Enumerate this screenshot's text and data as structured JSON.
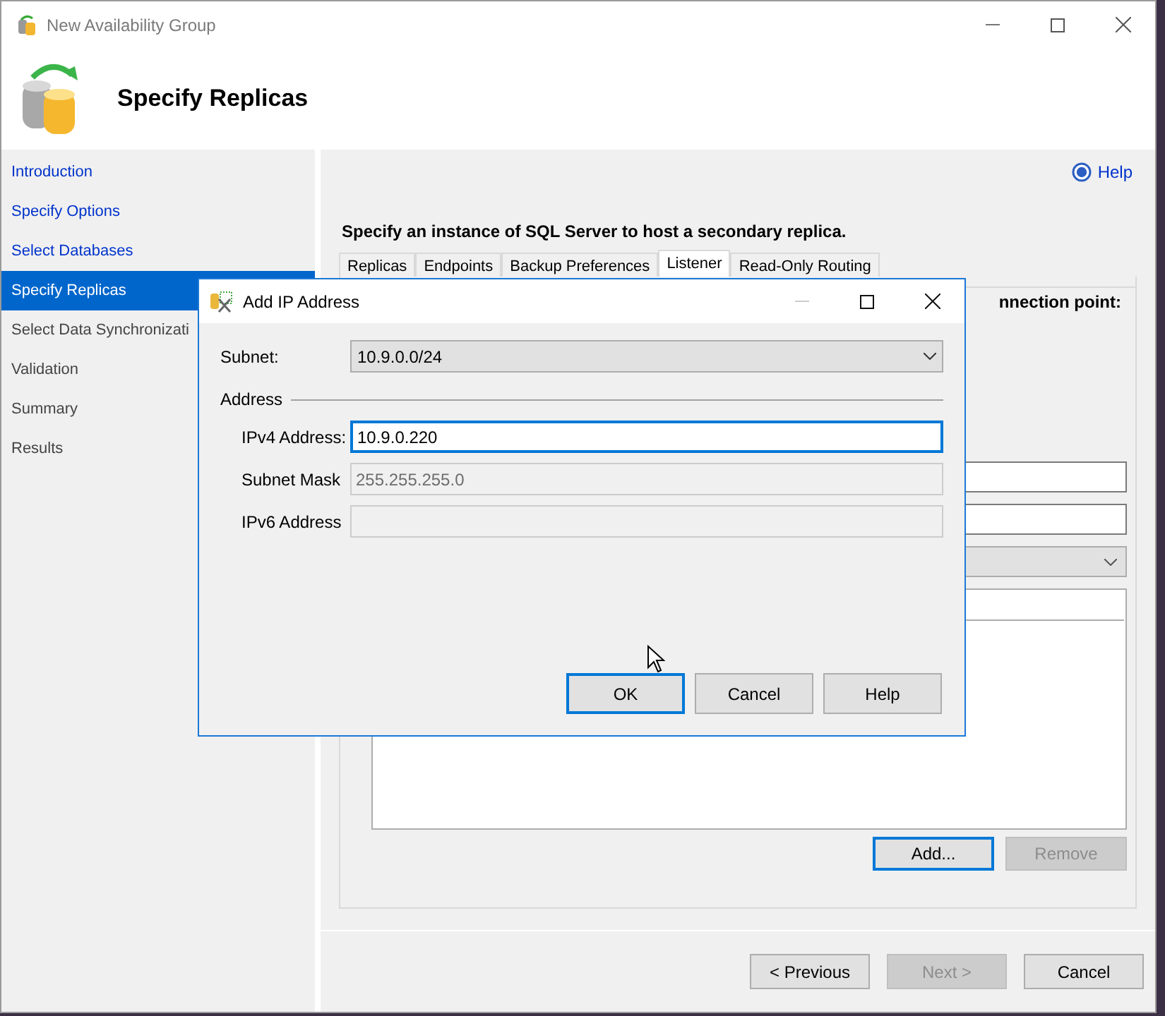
{
  "window": {
    "title": "New Availability Group",
    "page_title": "Specify Replicas"
  },
  "nav": {
    "items": [
      {
        "label": "Introduction",
        "selected": false,
        "visited": true
      },
      {
        "label": "Specify Options",
        "selected": false,
        "visited": true
      },
      {
        "label": "Select Databases",
        "selected": false,
        "visited": true
      },
      {
        "label": "Specify Replicas",
        "selected": true,
        "visited": true
      },
      {
        "label": "Select Data Synchronizati",
        "selected": false,
        "visited": false
      },
      {
        "label": "Validation",
        "selected": false,
        "visited": false
      },
      {
        "label": "Summary",
        "selected": false,
        "visited": false
      },
      {
        "label": "Results",
        "selected": false,
        "visited": false
      }
    ]
  },
  "help_link": "Help",
  "instruction": "Specify an instance of SQL Server to host a secondary replica.",
  "tabs": [
    {
      "label": "Replicas",
      "selected": false
    },
    {
      "label": "Endpoints",
      "selected": false
    },
    {
      "label": "Backup Preferences",
      "selected": false
    },
    {
      "label": "Listener",
      "selected": true
    },
    {
      "label": "Read-Only Routing",
      "selected": false
    }
  ],
  "listener_panel": {
    "caption": "nnection point:",
    "buttons": [
      {
        "label": "Add...",
        "focused": true,
        "disabled": false
      },
      {
        "label": "Remove",
        "focused": false,
        "disabled": true
      }
    ]
  },
  "footer_buttons": [
    {
      "label": "< Previous",
      "disabled": false
    },
    {
      "label": "Next >",
      "disabled": true
    },
    {
      "label": "Cancel",
      "disabled": false
    }
  ],
  "dialog": {
    "title": "Add IP Address",
    "subnet": {
      "label": "Subnet:",
      "value": "10.9.0.0/24"
    },
    "group_label": "Address",
    "fields": [
      {
        "label": "IPv4 Address:",
        "value": "10.9.0.220",
        "disabled": false,
        "focused": true
      },
      {
        "label": "Subnet Mask",
        "value": "255.255.255.0",
        "disabled": true,
        "focused": false
      },
      {
        "label": "IPv6 Address",
        "disabled": true,
        "focused": false
      }
    ],
    "buttons": [
      {
        "label": "OK",
        "default": true
      },
      {
        "label": "Cancel",
        "default": false
      },
      {
        "label": "Help",
        "default": false
      }
    ]
  }
}
